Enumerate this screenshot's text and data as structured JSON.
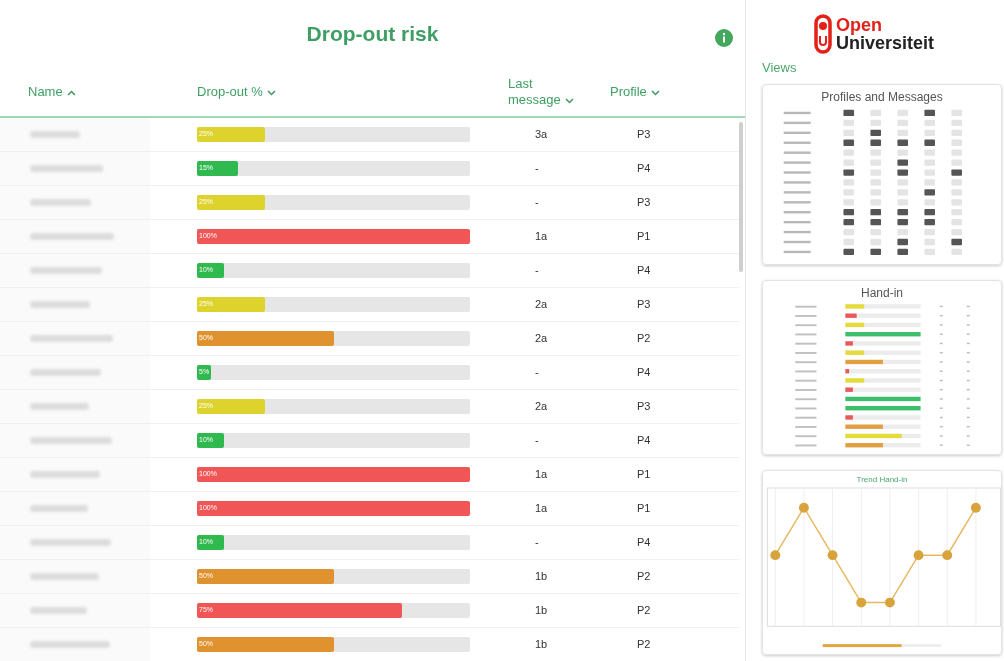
{
  "title": "Drop-out risk",
  "columns": [
    {
      "label": "Name",
      "ascending": true
    },
    {
      "label": "Drop-out %",
      "ascending": false
    },
    {
      "label": "Last message",
      "ascending": false
    },
    {
      "label": "Profile",
      "ascending": false
    }
  ],
  "rows": [
    {
      "level": 0.25,
      "percent": "25%",
      "color": "#ddd32c",
      "message": "3a",
      "profile": "P3"
    },
    {
      "level": 0.15,
      "percent": "15%",
      "color": "#2fb94f",
      "message": "-",
      "profile": "P4"
    },
    {
      "level": 0.25,
      "percent": "25%",
      "color": "#ddd32c",
      "message": "-",
      "profile": "P3"
    },
    {
      "level": 1,
      "percent": "100%",
      "color": "#f05656",
      "message": "1a",
      "profile": "P1"
    },
    {
      "level": 0.1,
      "percent": "10%",
      "color": "#2fb94f",
      "message": "-",
      "profile": "P4"
    },
    {
      "level": 0.25,
      "percent": "25%",
      "color": "#ddd32c",
      "message": "2a",
      "profile": "P3"
    },
    {
      "level": 0.5,
      "percent": "50%",
      "color": "#e0922f",
      "message": "2a",
      "profile": "P2"
    },
    {
      "level": 0.05,
      "percent": "5%",
      "color": "#2fb94f",
      "message": "-",
      "profile": "P4"
    },
    {
      "level": 0.25,
      "percent": "25%",
      "color": "#ddd32c",
      "message": "2a",
      "profile": "P3"
    },
    {
      "level": 0.1,
      "percent": "10%",
      "color": "#2fb94f",
      "message": "-",
      "profile": "P4"
    },
    {
      "level": 1,
      "percent": "100%",
      "color": "#f05656",
      "message": "1a",
      "profile": "P1"
    },
    {
      "level": 1,
      "percent": "100%",
      "color": "#f05656",
      "message": "1a",
      "profile": "P1"
    },
    {
      "level": 0.1,
      "percent": "10%",
      "color": "#2fb94f",
      "message": "-",
      "profile": "P4"
    },
    {
      "level": 0.5,
      "percent": "50%",
      "color": "#e0922f",
      "message": "1b",
      "profile": "P2"
    },
    {
      "level": 0.75,
      "percent": "75%",
      "color": "#f05656",
      "message": "1b",
      "profile": "P2"
    },
    {
      "level": 0.5,
      "percent": "50%",
      "color": "#e0922f",
      "message": "1b",
      "profile": "P2"
    }
  ],
  "logo": {
    "line_1": "Open",
    "line_2": "Universiteit"
  },
  "views_label": "Views",
  "views": [
    {
      "kind": "grid",
      "title": "Profiles and Messages"
    },
    {
      "kind": "bars",
      "title": "Hand-in"
    },
    {
      "kind": "trend",
      "title": "Trend Hand-in"
    }
  ]
}
